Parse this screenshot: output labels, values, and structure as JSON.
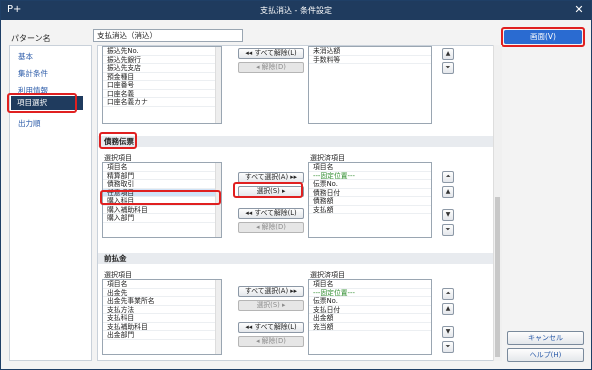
{
  "window": {
    "title": "支払消込 - 条件設定",
    "app_icon": "P+",
    "close_glyph": "✕"
  },
  "pattern": {
    "label": "パターン名",
    "value": "支払消込（消込）"
  },
  "screen_button": {
    "label": "画面(V)"
  },
  "sidebar": {
    "items": [
      {
        "label": "基本"
      },
      {
        "label": "集計条件"
      },
      {
        "label": "利用情報"
      },
      {
        "label": "項目選択",
        "selected": true
      },
      {
        "label": "出力順"
      }
    ]
  },
  "top_section": {
    "left_rows": [
      "振込先No.",
      "振込先銀行",
      "振込先支店",
      "預金種目",
      "口座番号",
      "口座名義",
      "口座名義カナ"
    ],
    "right_rows": [
      "未消込額",
      "手数料等"
    ],
    "btn_deselect_all": "◂◂ すべて解除(L)",
    "btn_deselect": "◂  解除(D)"
  },
  "saimu_section": {
    "title": "債務伝票",
    "left_label": "選択項目",
    "right_label": "選択済項目",
    "left_rows": [
      "項目名",
      "精算部門",
      "債務取引",
      "任意項目",
      "購入科目",
      "購入補助科目",
      "購入部門"
    ],
    "right_rows": [
      "項目名",
      "---固定位置---",
      "伝票No.",
      "債務日付",
      "債務額",
      "支払額"
    ],
    "btn_select_all": "すべて選択(A) ▸▸",
    "btn_select": "選択(S)   ▸",
    "btn_deselect_all": "◂◂ すべて解除(L)",
    "btn_deselect": "◂  解除(D)"
  },
  "maebarai_section": {
    "title": "前払金",
    "left_label": "選択項目",
    "right_label": "選択済項目",
    "left_rows": [
      "項目名",
      "出金先",
      "出金先事業所名",
      "支払方法",
      "支払科目",
      "支払補助科目",
      "出金部門"
    ],
    "right_rows": [
      "項目名",
      "---固定位置---",
      "伝票No.",
      "支払日付",
      "出金額",
      "充当額"
    ],
    "btn_select_all": "すべて選択(A) ▸▸",
    "btn_select": "選択(S)   ▸",
    "btn_deselect_all": "◂◂ すべて解除(L)",
    "btn_deselect": "◂  解除(D)"
  },
  "side_arrows": {
    "top": "⏶",
    "up": "▲",
    "down": "▼",
    "bottom": "⏷"
  },
  "footer": {
    "cancel": "キャンセル",
    "help": "ヘルプ(H)"
  }
}
